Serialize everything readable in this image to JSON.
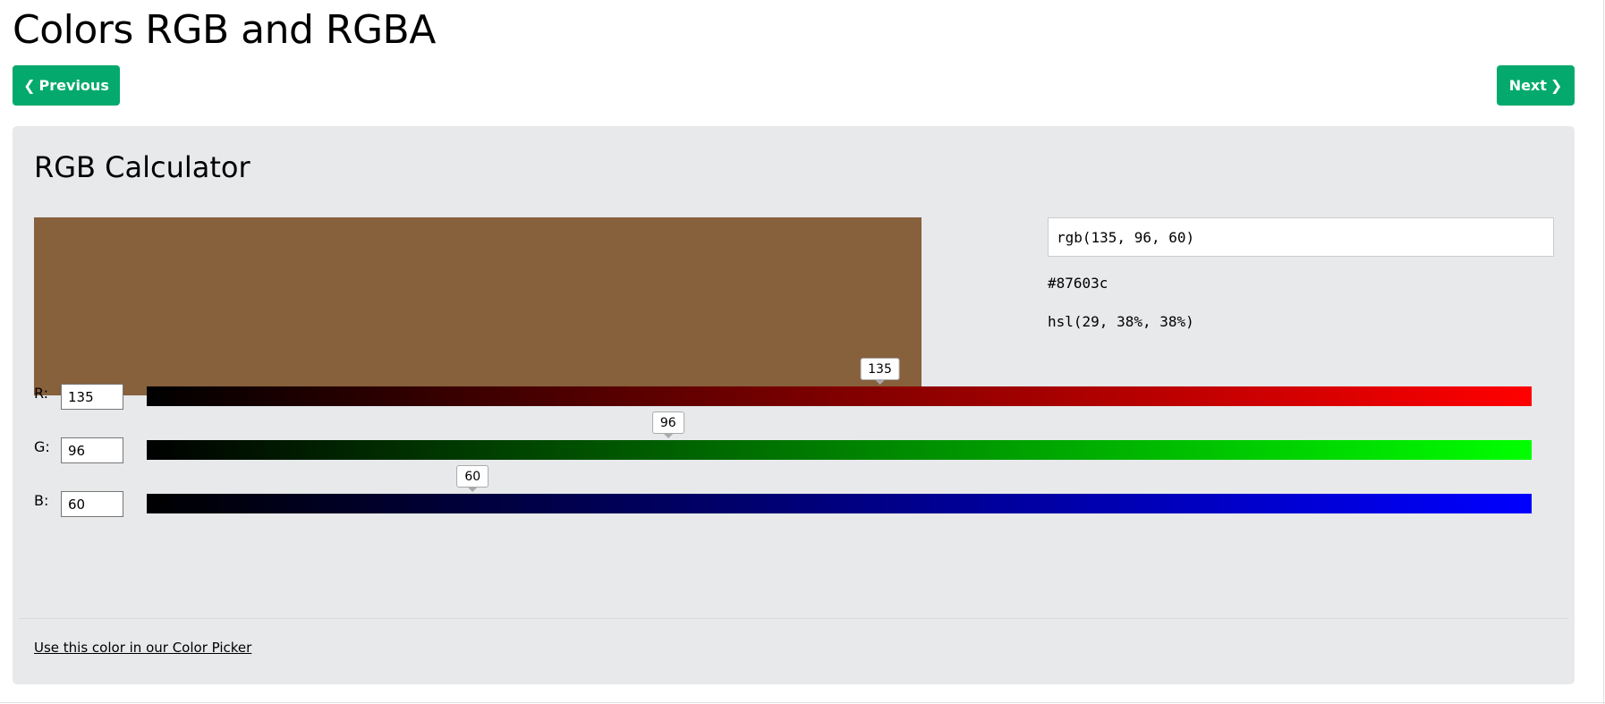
{
  "page": {
    "title": "Colors RGB and RGBA"
  },
  "nav": {
    "prev_label": "Previous",
    "next_label": "Next",
    "prev_icon": "chevron-left-icon",
    "next_icon": "chevron-right-icon",
    "button_color": "#04aa6d"
  },
  "calculator": {
    "title": "RGB Calculator",
    "swatch_color": "#87603c",
    "rgb_value": "rgb(135, 96, 60)",
    "hex_value": "#87603c",
    "hsl_value": "hsl(29, 38%, 38%)",
    "sliders": [
      {
        "label": "R:",
        "value": "135",
        "max": 255
      },
      {
        "label": "G:",
        "value": "96",
        "max": 255
      },
      {
        "label": "B:",
        "value": "60",
        "max": 255
      }
    ],
    "picker_link": "Use this color in our Color Picker"
  }
}
